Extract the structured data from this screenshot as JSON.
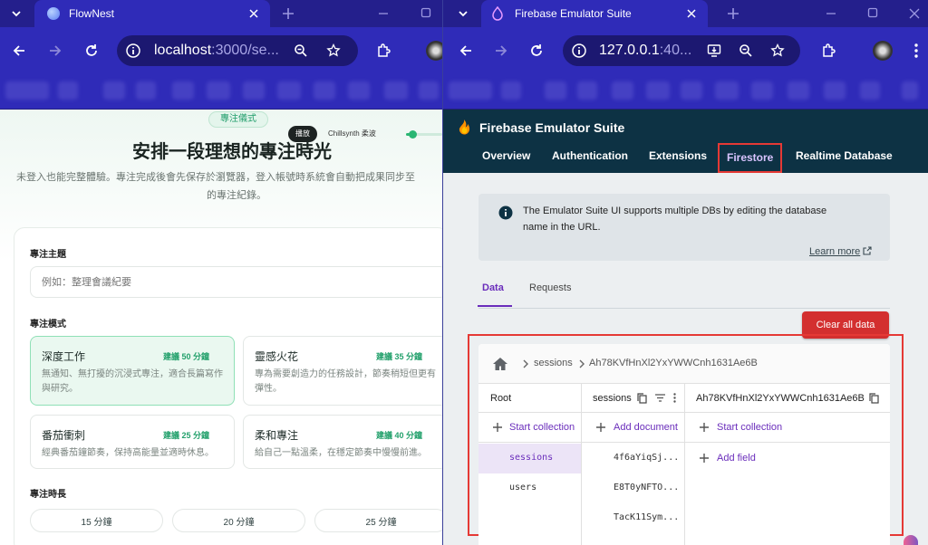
{
  "left_window": {
    "tab_title": "FlowNest",
    "url_host": "localhost",
    "url_rest": ":3000/se...",
    "page": {
      "badge": "專注儀式",
      "player_button": "播放",
      "player_track": "Chillsynth 柔波",
      "heading": "安排一段理想的專注時光",
      "intro_line1": "未登入也能完整體驗。專注完成後會先保存於瀏覽器，登入帳號時系統會自動把成果同步至",
      "intro_line2": "的專注紀錄。",
      "topic_label": "專注主題",
      "topic_placeholder": "例如：整理會議紀要",
      "mode_label": "專注模式",
      "modes": [
        {
          "title": "深度工作",
          "badge": "建議 50 分鐘",
          "desc": "無通知、無打擾的沉浸式專注，適合長篇寫作與研究。"
        },
        {
          "title": "靈感火花",
          "badge": "建議 35 分鐘",
          "desc": "專為需要創造力的任務設計，節奏稍短但更有彈性。"
        },
        {
          "title": "番茄衝刺",
          "badge": "建議 25 分鐘",
          "desc": "經典番茄鐘節奏，保持高能量並適時休息。"
        },
        {
          "title": "柔和專注",
          "badge": "建議 40 分鐘",
          "desc": "給自己一點溫柔，在穩定節奏中慢慢前進。"
        }
      ],
      "duration_label": "專注時長",
      "durations": [
        "15 分鐘",
        "20 分鐘",
        "25 分鐘"
      ]
    }
  },
  "right_window": {
    "tab_title": "Firebase Emulator Suite",
    "url_host": "127.0.0.1",
    "url_rest": ":40...",
    "app_title": "Firebase Emulator Suite",
    "nav": [
      "Overview",
      "Authentication",
      "Extensions",
      "Firestore",
      "Realtime Database"
    ],
    "active_nav": "Firestore",
    "info": {
      "line1": "The Emulator Suite UI supports multiple DBs by editing the database",
      "line2": "name in the URL.",
      "learn_more": "Learn more"
    },
    "subtabs": [
      "Data",
      "Requests"
    ],
    "clear_button": "Clear all data",
    "breadcrumb": {
      "collection": "sessions",
      "document": "Ah78KVfHnXl2YxYWWCnh1631Ae6B"
    },
    "columns": {
      "root": {
        "title": "Root",
        "action": "Start collection",
        "items": [
          "sessions",
          "users"
        ]
      },
      "collection": {
        "title": "sessions",
        "action": "Add document",
        "items": [
          "4f6aYiqSj...",
          "E8T0yNFTO...",
          "TacK11Sym..."
        ]
      },
      "document": {
        "title": "Ah78KVfHnXl2YxYWWCnh1631Ae6B",
        "actions": [
          "Start collection",
          "Add field"
        ]
      }
    },
    "colors": {
      "accent": "#6a2dbb",
      "highlight": "#e53935",
      "header": "#0d3244",
      "tabstrip": "#241f8c"
    }
  }
}
